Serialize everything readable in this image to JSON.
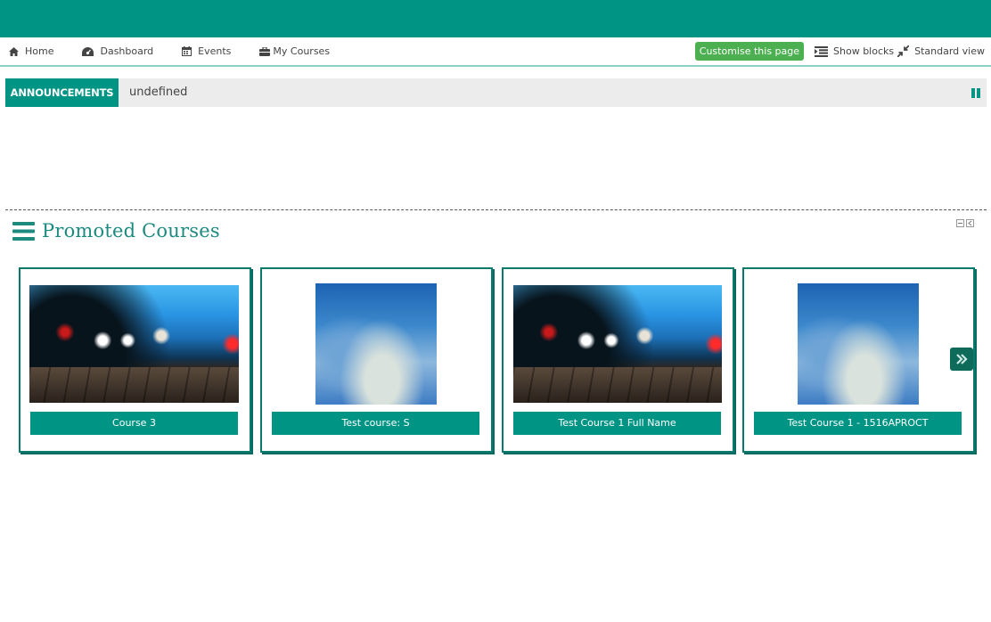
{
  "nav": {
    "home": "Home",
    "dashboard": "Dashboard",
    "events": "Events",
    "my_courses": "My Courses",
    "customise": "Customise this page",
    "show_blocks": "Show blocks",
    "standard_view": "Standard view"
  },
  "announcements": {
    "label": "ANNOUNCEMENTS",
    "text": "undefined"
  },
  "promoted": {
    "title": "Promoted Courses",
    "courses": [
      {
        "name": "Course 3",
        "image": "night-city-lights-image"
      },
      {
        "name": "Test course: S",
        "image": "blurred-blue-image"
      },
      {
        "name": "Test Course 1 Full Name",
        "image": "night-city-lights-image"
      },
      {
        "name": "Test Course 1 - 1516APROCT",
        "image": "blurred-blue-image"
      }
    ]
  },
  "colors": {
    "brand": "#009484",
    "customise_button": "#4caf50",
    "arrow": "#0e6b5a"
  }
}
